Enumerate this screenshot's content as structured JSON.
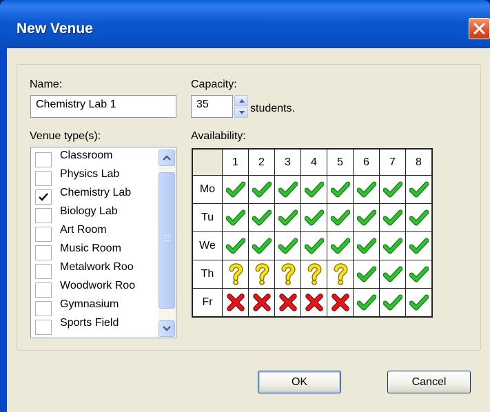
{
  "window": {
    "title": "New Venue"
  },
  "name": {
    "label": "Name:",
    "value": "Chemistry Lab 1"
  },
  "capacity": {
    "label": "Capacity:",
    "value": "35",
    "suffix": "students."
  },
  "venue_types": {
    "label": "Venue type(s):",
    "items": [
      {
        "label": "Classroom",
        "checked": false
      },
      {
        "label": "Physics Lab",
        "checked": false
      },
      {
        "label": "Chemistry Lab",
        "checked": true
      },
      {
        "label": "Biology Lab",
        "checked": false
      },
      {
        "label": "Art Room",
        "checked": false
      },
      {
        "label": "Music Room",
        "checked": false
      },
      {
        "label": "Metalwork Roo",
        "checked": false
      },
      {
        "label": "Woodwork Roo",
        "checked": false
      },
      {
        "label": "Gymnasium",
        "checked": false
      },
      {
        "label": "Sports Field",
        "checked": false
      }
    ]
  },
  "availability": {
    "label": "Availability:",
    "periods": [
      "1",
      "2",
      "3",
      "4",
      "5",
      "6",
      "7",
      "8"
    ],
    "days": [
      "Mo",
      "Tu",
      "We",
      "Th",
      "Fr"
    ],
    "status": [
      [
        "yes",
        "yes",
        "yes",
        "yes",
        "yes",
        "yes",
        "yes",
        "yes"
      ],
      [
        "yes",
        "yes",
        "yes",
        "yes",
        "yes",
        "yes",
        "yes",
        "yes"
      ],
      [
        "yes",
        "yes",
        "yes",
        "yes",
        "yes",
        "yes",
        "yes",
        "yes"
      ],
      [
        "maybe",
        "maybe",
        "maybe",
        "maybe",
        "maybe",
        "yes",
        "yes",
        "yes"
      ],
      [
        "no",
        "no",
        "no",
        "no",
        "no",
        "yes",
        "yes",
        "yes"
      ]
    ]
  },
  "buttons": {
    "ok": "OK",
    "cancel": "Cancel"
  },
  "colors": {
    "yes": "#2fc12f",
    "maybe": "#f6e414",
    "no": "#e8141a",
    "title_bar": "#0a50c5"
  }
}
